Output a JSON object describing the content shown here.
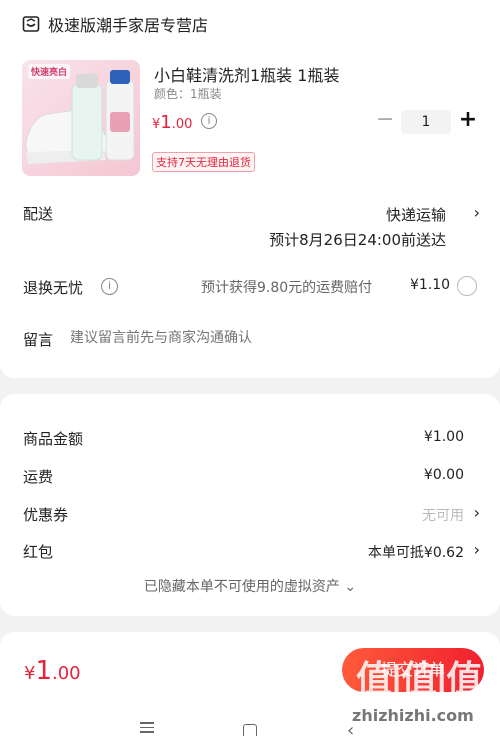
{
  "store": {
    "name": "极速版潮手家居专营店"
  },
  "product": {
    "thumb_tag": "快速亮白",
    "title": "小白鞋清洗剂1瓶装 1瓶装",
    "variant": "颜色：1瓶装",
    "price_symbol": "¥",
    "price_int": "1",
    "price_dec": ".00",
    "quantity": "1",
    "minus": "−",
    "plus": "+",
    "badge": "支持7天无理由退货"
  },
  "delivery": {
    "label": "配送",
    "method": "快递运输",
    "eta": "预计8月26日24:00前送达"
  },
  "return_ins": {
    "label": "退换无忧",
    "desc": "预计获得9.80元的运费赔付",
    "fee": "¥1.10"
  },
  "note": {
    "label": "留言",
    "placeholder": "建议留言前先与商家沟通确认"
  },
  "summary": {
    "goods_label": "商品金额",
    "goods_value": "¥1.00",
    "shipping_label": "运费",
    "shipping_value": "¥0.00",
    "coupon_label": "优惠券",
    "coupon_value": "无可用",
    "redpacket_label": "红包",
    "redpacket_value": "本单可抵¥0.62",
    "hidden_assets": "已隐藏本单不可使用的虚拟资产 ⌄"
  },
  "footer": {
    "total_symbol": "¥",
    "total_int": "1",
    "total_dec": ".00",
    "submit_label": "提交订单"
  },
  "watermark": {
    "logo": "值|值|值",
    "site": "zhizhizhi.com"
  },
  "colors": {
    "accent": "#e6233c",
    "button": "#f0202e"
  }
}
